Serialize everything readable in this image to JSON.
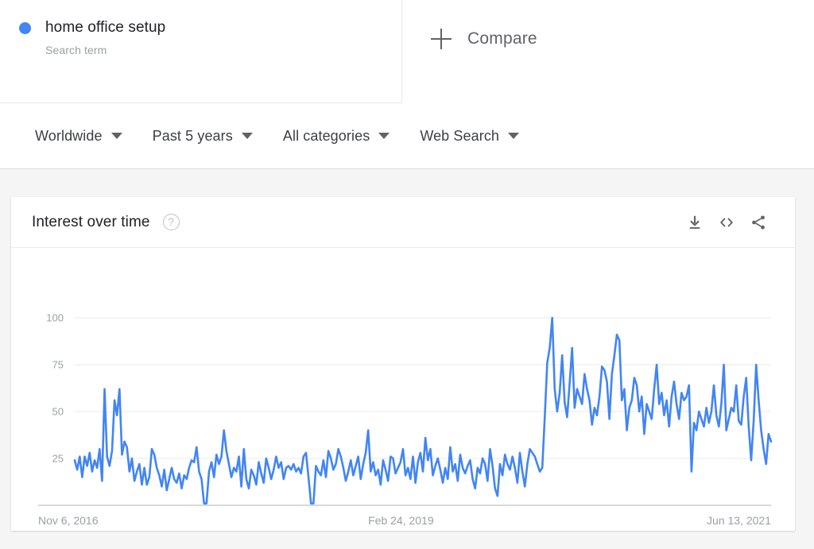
{
  "terms": [
    {
      "name": "home office setup",
      "type_label": "Search term",
      "color": "#4285f4"
    }
  ],
  "compare": {
    "label": "Compare",
    "icon": "plus-icon"
  },
  "filters": [
    {
      "label": "Worldwide",
      "name": "location"
    },
    {
      "label": "Past 5 years",
      "name": "time-range"
    },
    {
      "label": "All categories",
      "name": "category"
    },
    {
      "label": "Web Search",
      "name": "search-type"
    }
  ],
  "card": {
    "title": "Interest over time",
    "help_icon": "?",
    "actions": [
      {
        "name": "download-icon",
        "label": "Download"
      },
      {
        "name": "embed-code-icon",
        "label": "Embed"
      },
      {
        "name": "share-icon",
        "label": "Share"
      }
    ]
  },
  "chart_data": {
    "type": "line",
    "title": "Interest over time",
    "xlabel": "",
    "ylabel": "",
    "ylim": [
      0,
      100
    ],
    "grid": true,
    "legend_position": "top",
    "y_ticks": [
      100,
      75,
      50,
      25
    ],
    "x_ticks": [
      "Nov 6, 2016",
      "Feb 24, 2019",
      "Jun 13, 2021"
    ],
    "x_tick_positions": [
      0,
      0.495,
      0.965
    ],
    "series": [
      {
        "name": "home office setup",
        "color": "#4285f4",
        "values": [
          24,
          19,
          26,
          15,
          26,
          21,
          28,
          18,
          24,
          20,
          30,
          13,
          62,
          26,
          21,
          29,
          56,
          48,
          62,
          27,
          34,
          31,
          18,
          25,
          13,
          18,
          22,
          11,
          20,
          11,
          15,
          30,
          27,
          20,
          16,
          10,
          19,
          8,
          14,
          20,
          14,
          12,
          17,
          9,
          16,
          14,
          20,
          24,
          23,
          31,
          18,
          14,
          1,
          1,
          18,
          23,
          15,
          27,
          22,
          26,
          40,
          29,
          22,
          15,
          20,
          18,
          26,
          10,
          30,
          14,
          9,
          19,
          16,
          11,
          23,
          17,
          12,
          25,
          20,
          14,
          19,
          26,
          20,
          23,
          14,
          20,
          21,
          19,
          22,
          18,
          20,
          17,
          26,
          28,
          15,
          1,
          1,
          21,
          18,
          16,
          24,
          15,
          29,
          25,
          19,
          22,
          30,
          26,
          20,
          13,
          18,
          24,
          16,
          21,
          26,
          14,
          22,
          28,
          40,
          18,
          23,
          16,
          19,
          11,
          24,
          19,
          13,
          26,
          25,
          17,
          20,
          23,
          30,
          16,
          20,
          14,
          26,
          12,
          23,
          28,
          18,
          36,
          24,
          30,
          16,
          21,
          25,
          19,
          12,
          20,
          14,
          31,
          18,
          22,
          13,
          27,
          20,
          17,
          21,
          24,
          14,
          9,
          20,
          17,
          25,
          22,
          13,
          30,
          21,
          9,
          5,
          22,
          16,
          27,
          22,
          19,
          26,
          20,
          12,
          28,
          18,
          10,
          22,
          30,
          28,
          26,
          22,
          18,
          20,
          47,
          76,
          84,
          100,
          62,
          50,
          60,
          80,
          55,
          47,
          65,
          84,
          52,
          62,
          58,
          54,
          70,
          62,
          56,
          43,
          52,
          48,
          58,
          74,
          72,
          66,
          46,
          70,
          80,
          91,
          88,
          56,
          62,
          40,
          52,
          56,
          68,
          64,
          50,
          58,
          38,
          54,
          50,
          46,
          62,
          75,
          54,
          60,
          48,
          56,
          42,
          58,
          66,
          54,
          46,
          60,
          56,
          58,
          64,
          18,
          44,
          40,
          50,
          46,
          42,
          52,
          44,
          50,
          64,
          48,
          42,
          54,
          75,
          40,
          46,
          52,
          50,
          64,
          45,
          43,
          58,
          68,
          42,
          24,
          45,
          75,
          56,
          40,
          30,
          22,
          38,
          34
        ]
      }
    ]
  }
}
